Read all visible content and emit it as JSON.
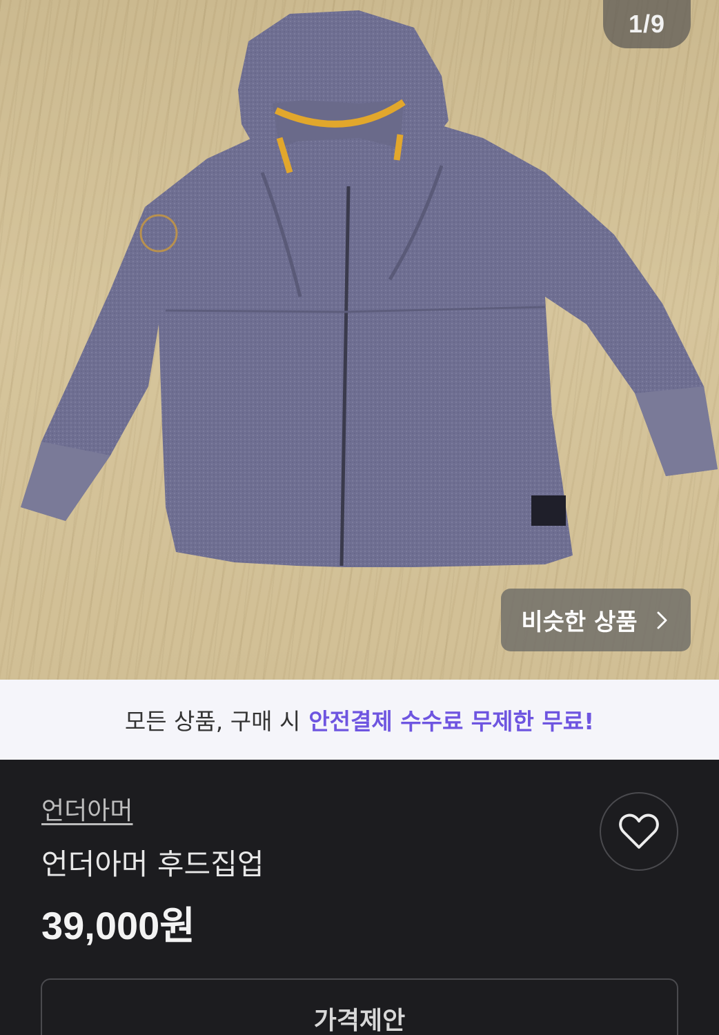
{
  "gallery": {
    "counter": "1/9",
    "similar_label": "비슷한 상품",
    "chevron_icon": "chevron-right-icon"
  },
  "banner": {
    "prefix": "모든 상품, 구매 시",
    "highlight": "안전결제 수수료 무제한 무료!",
    "highlight_color": "#6e55e0"
  },
  "product": {
    "brand": "언더아머",
    "title": "언더아머 후드집업",
    "price": "39,000원",
    "like_icon": "heart-outline-icon",
    "offer_label": "가격제안"
  }
}
